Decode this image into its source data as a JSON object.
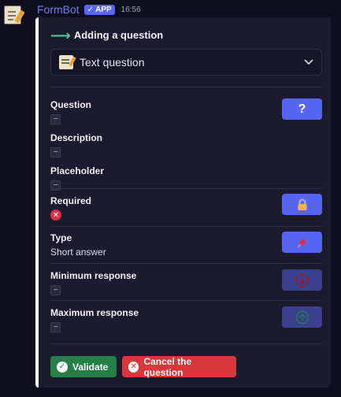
{
  "message": {
    "bot_name": "FormBot",
    "badge": "APP",
    "badge_check": "✓",
    "timestamp": "16:56"
  },
  "embed": {
    "title": "Adding a question",
    "title_icon": "arrow-right-icon",
    "select": {
      "selected": "Text question",
      "icon": "memo-icon"
    },
    "fields": {
      "question": {
        "label": "Question",
        "value": "–"
      },
      "description": {
        "label": "Description",
        "value": "–"
      },
      "placeholder": {
        "label": "Placeholder",
        "value": "–"
      },
      "required": {
        "label": "Required",
        "value_icon": "x-icon",
        "value_glyph": "✕"
      },
      "type": {
        "label": "Type",
        "value": "Short answer"
      },
      "min": {
        "label": "Minimum response",
        "value": "–"
      },
      "max": {
        "label": "Maximum response",
        "value": "–"
      }
    },
    "side_buttons": {
      "question_glyph": "?",
      "required_icon": "lock-icon",
      "type_icon": "pushpin-icon",
      "min_icon": "arrow-down-circle-icon",
      "max_icon": "arrow-up-circle-icon"
    },
    "actions": {
      "validate_label": "Validate",
      "cancel_label": "Cancel the question",
      "check_glyph": "✓",
      "x_glyph": "✕"
    }
  },
  "colors": {
    "accent": "#5865f2",
    "green": "#248046",
    "red": "#da373c",
    "background": "#1b1a2e"
  }
}
